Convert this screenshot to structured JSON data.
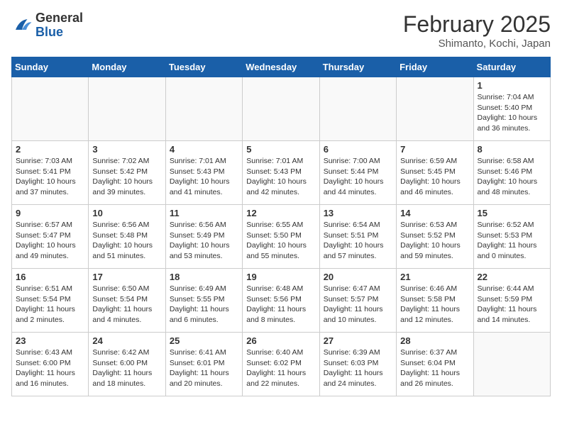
{
  "header": {
    "logo_general": "General",
    "logo_blue": "Blue",
    "month_year": "February 2025",
    "location": "Shimanto, Kochi, Japan"
  },
  "days_of_week": [
    "Sunday",
    "Monday",
    "Tuesday",
    "Wednesday",
    "Thursday",
    "Friday",
    "Saturday"
  ],
  "weeks": [
    [
      {
        "day": "",
        "info": ""
      },
      {
        "day": "",
        "info": ""
      },
      {
        "day": "",
        "info": ""
      },
      {
        "day": "",
        "info": ""
      },
      {
        "day": "",
        "info": ""
      },
      {
        "day": "",
        "info": ""
      },
      {
        "day": "1",
        "info": "Sunrise: 7:04 AM\nSunset: 5:40 PM\nDaylight: 10 hours and 36 minutes."
      }
    ],
    [
      {
        "day": "2",
        "info": "Sunrise: 7:03 AM\nSunset: 5:41 PM\nDaylight: 10 hours and 37 minutes."
      },
      {
        "day": "3",
        "info": "Sunrise: 7:02 AM\nSunset: 5:42 PM\nDaylight: 10 hours and 39 minutes."
      },
      {
        "day": "4",
        "info": "Sunrise: 7:01 AM\nSunset: 5:43 PM\nDaylight: 10 hours and 41 minutes."
      },
      {
        "day": "5",
        "info": "Sunrise: 7:01 AM\nSunset: 5:43 PM\nDaylight: 10 hours and 42 minutes."
      },
      {
        "day": "6",
        "info": "Sunrise: 7:00 AM\nSunset: 5:44 PM\nDaylight: 10 hours and 44 minutes."
      },
      {
        "day": "7",
        "info": "Sunrise: 6:59 AM\nSunset: 5:45 PM\nDaylight: 10 hours and 46 minutes."
      },
      {
        "day": "8",
        "info": "Sunrise: 6:58 AM\nSunset: 5:46 PM\nDaylight: 10 hours and 48 minutes."
      }
    ],
    [
      {
        "day": "9",
        "info": "Sunrise: 6:57 AM\nSunset: 5:47 PM\nDaylight: 10 hours and 49 minutes."
      },
      {
        "day": "10",
        "info": "Sunrise: 6:56 AM\nSunset: 5:48 PM\nDaylight: 10 hours and 51 minutes."
      },
      {
        "day": "11",
        "info": "Sunrise: 6:56 AM\nSunset: 5:49 PM\nDaylight: 10 hours and 53 minutes."
      },
      {
        "day": "12",
        "info": "Sunrise: 6:55 AM\nSunset: 5:50 PM\nDaylight: 10 hours and 55 minutes."
      },
      {
        "day": "13",
        "info": "Sunrise: 6:54 AM\nSunset: 5:51 PM\nDaylight: 10 hours and 57 minutes."
      },
      {
        "day": "14",
        "info": "Sunrise: 6:53 AM\nSunset: 5:52 PM\nDaylight: 10 hours and 59 minutes."
      },
      {
        "day": "15",
        "info": "Sunrise: 6:52 AM\nSunset: 5:53 PM\nDaylight: 11 hours and 0 minutes."
      }
    ],
    [
      {
        "day": "16",
        "info": "Sunrise: 6:51 AM\nSunset: 5:54 PM\nDaylight: 11 hours and 2 minutes."
      },
      {
        "day": "17",
        "info": "Sunrise: 6:50 AM\nSunset: 5:54 PM\nDaylight: 11 hours and 4 minutes."
      },
      {
        "day": "18",
        "info": "Sunrise: 6:49 AM\nSunset: 5:55 PM\nDaylight: 11 hours and 6 minutes."
      },
      {
        "day": "19",
        "info": "Sunrise: 6:48 AM\nSunset: 5:56 PM\nDaylight: 11 hours and 8 minutes."
      },
      {
        "day": "20",
        "info": "Sunrise: 6:47 AM\nSunset: 5:57 PM\nDaylight: 11 hours and 10 minutes."
      },
      {
        "day": "21",
        "info": "Sunrise: 6:46 AM\nSunset: 5:58 PM\nDaylight: 11 hours and 12 minutes."
      },
      {
        "day": "22",
        "info": "Sunrise: 6:44 AM\nSunset: 5:59 PM\nDaylight: 11 hours and 14 minutes."
      }
    ],
    [
      {
        "day": "23",
        "info": "Sunrise: 6:43 AM\nSunset: 6:00 PM\nDaylight: 11 hours and 16 minutes."
      },
      {
        "day": "24",
        "info": "Sunrise: 6:42 AM\nSunset: 6:00 PM\nDaylight: 11 hours and 18 minutes."
      },
      {
        "day": "25",
        "info": "Sunrise: 6:41 AM\nSunset: 6:01 PM\nDaylight: 11 hours and 20 minutes."
      },
      {
        "day": "26",
        "info": "Sunrise: 6:40 AM\nSunset: 6:02 PM\nDaylight: 11 hours and 22 minutes."
      },
      {
        "day": "27",
        "info": "Sunrise: 6:39 AM\nSunset: 6:03 PM\nDaylight: 11 hours and 24 minutes."
      },
      {
        "day": "28",
        "info": "Sunrise: 6:37 AM\nSunset: 6:04 PM\nDaylight: 11 hours and 26 minutes."
      },
      {
        "day": "",
        "info": ""
      }
    ]
  ]
}
